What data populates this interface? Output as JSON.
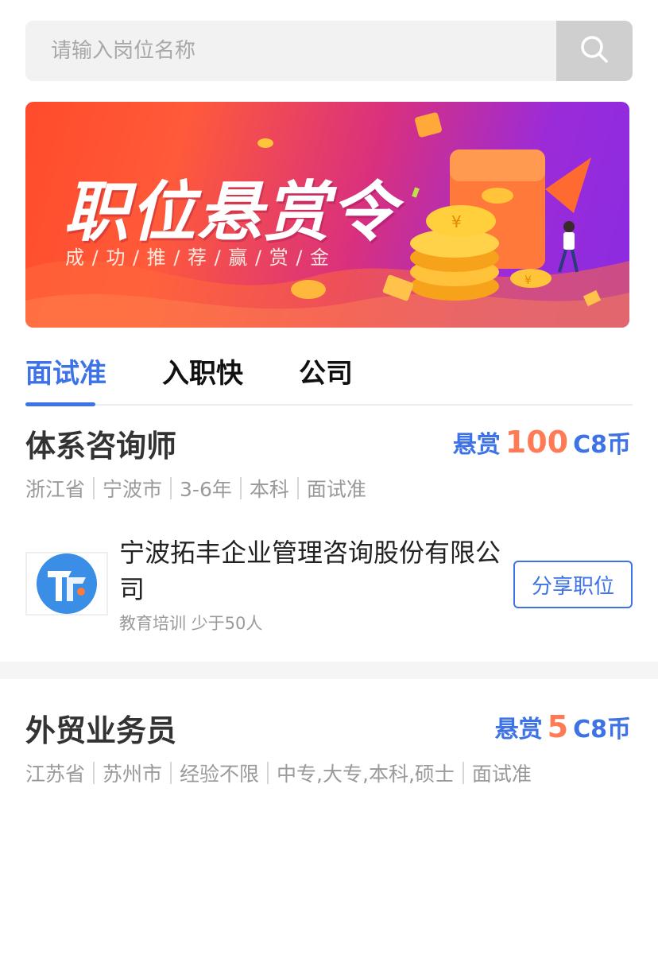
{
  "search": {
    "placeholder": "请输入岗位名称",
    "icon": "search-icon"
  },
  "banner": {
    "title": "职位悬赏令",
    "subtitle": "成 / 功 / 推 / 荐 / 赢 / 赏 / 金",
    "colors": {
      "start": "#ff4b2b",
      "end": "#8a2be2"
    }
  },
  "tabs": [
    {
      "label": "面试准",
      "active": true
    },
    {
      "label": "入职快",
      "active": false
    },
    {
      "label": "公司",
      "active": false
    }
  ],
  "jobs": [
    {
      "title": "体系咨询师",
      "reward_label": "悬赏",
      "reward_amount": "100",
      "reward_unit": "C8币",
      "tags": [
        "浙江省",
        "宁波市",
        "3-6年",
        "本科",
        "面试准"
      ],
      "company": {
        "name": "宁波拓丰企业管理咨询股份有限公司",
        "meta": "教育培训 少于50人",
        "share_label": "分享职位"
      }
    },
    {
      "title": "外贸业务员",
      "reward_label": "悬赏",
      "reward_amount": "5",
      "reward_unit": "C8币",
      "tags": [
        "江苏省",
        "苏州市",
        "经验不限",
        "中专,大专,本科,硕士",
        "面试准"
      ]
    }
  ],
  "colors": {
    "accent": "#3d73e6",
    "reward": "#ff7a55"
  }
}
